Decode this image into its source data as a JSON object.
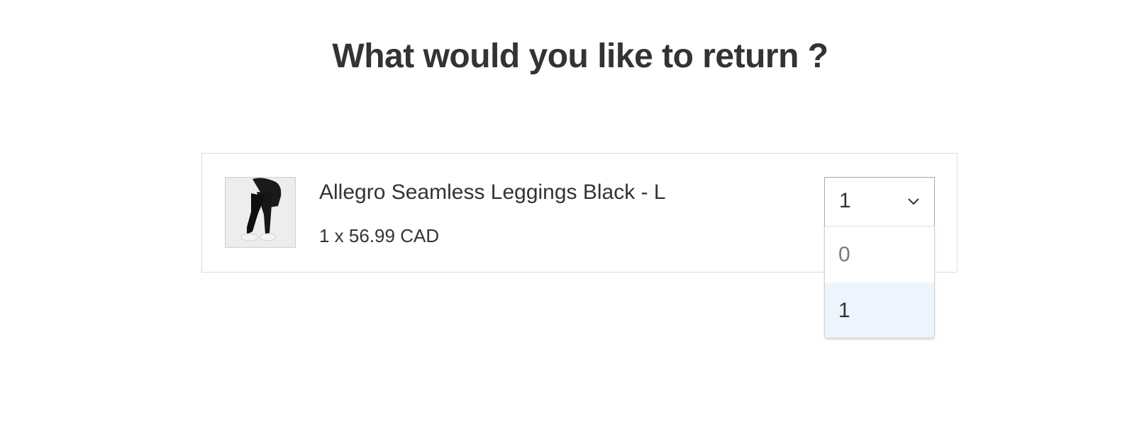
{
  "header": {
    "title": "What would you like to return ?"
  },
  "item": {
    "name": "Allegro Seamless Leggings Black - L",
    "price_line": "1 x 56.99 CAD",
    "image_icon": "leggings-product-thumbnail"
  },
  "quantity_select": {
    "selected": "1",
    "options": [
      "0",
      "1"
    ],
    "highlighted_option": "1",
    "icon": "chevron-down-icon"
  },
  "colors": {
    "text": "#333333",
    "border": "#dcdcdc",
    "highlight": "#edf4fd"
  }
}
